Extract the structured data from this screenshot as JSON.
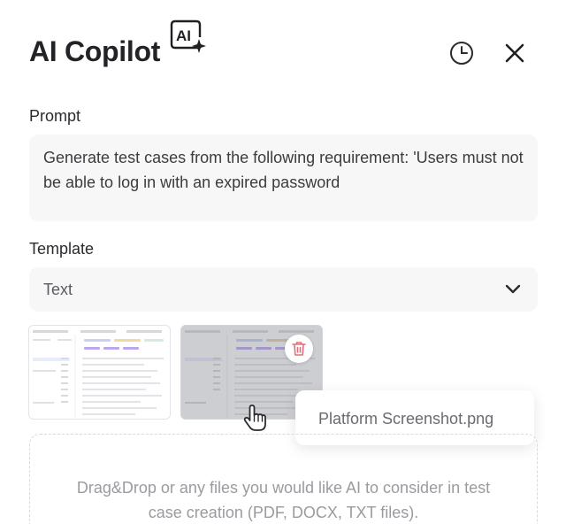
{
  "header": {
    "title": "AI Copilot",
    "badge_text": "AI",
    "history_icon": "clock-icon",
    "close_icon": "close-icon"
  },
  "prompt": {
    "label": "Prompt",
    "value": "Generate test cases from the following requirement: 'Users must not be able to log in with an expired password"
  },
  "template": {
    "label": "Template",
    "selected": "Text"
  },
  "attachments": {
    "tooltip": "Platform Screenshot.png",
    "delete_icon": "trash-icon",
    "cursor_icon": "hand-pointer-icon"
  },
  "dropzone": {
    "text": "Drag&Drop or any files you would like AI to consider in test case creation (PDF, DOCX, TXT files)."
  },
  "colors": {
    "accent_red": "#e2707a",
    "field_bg": "#f7f7f8",
    "title": "#222326"
  }
}
